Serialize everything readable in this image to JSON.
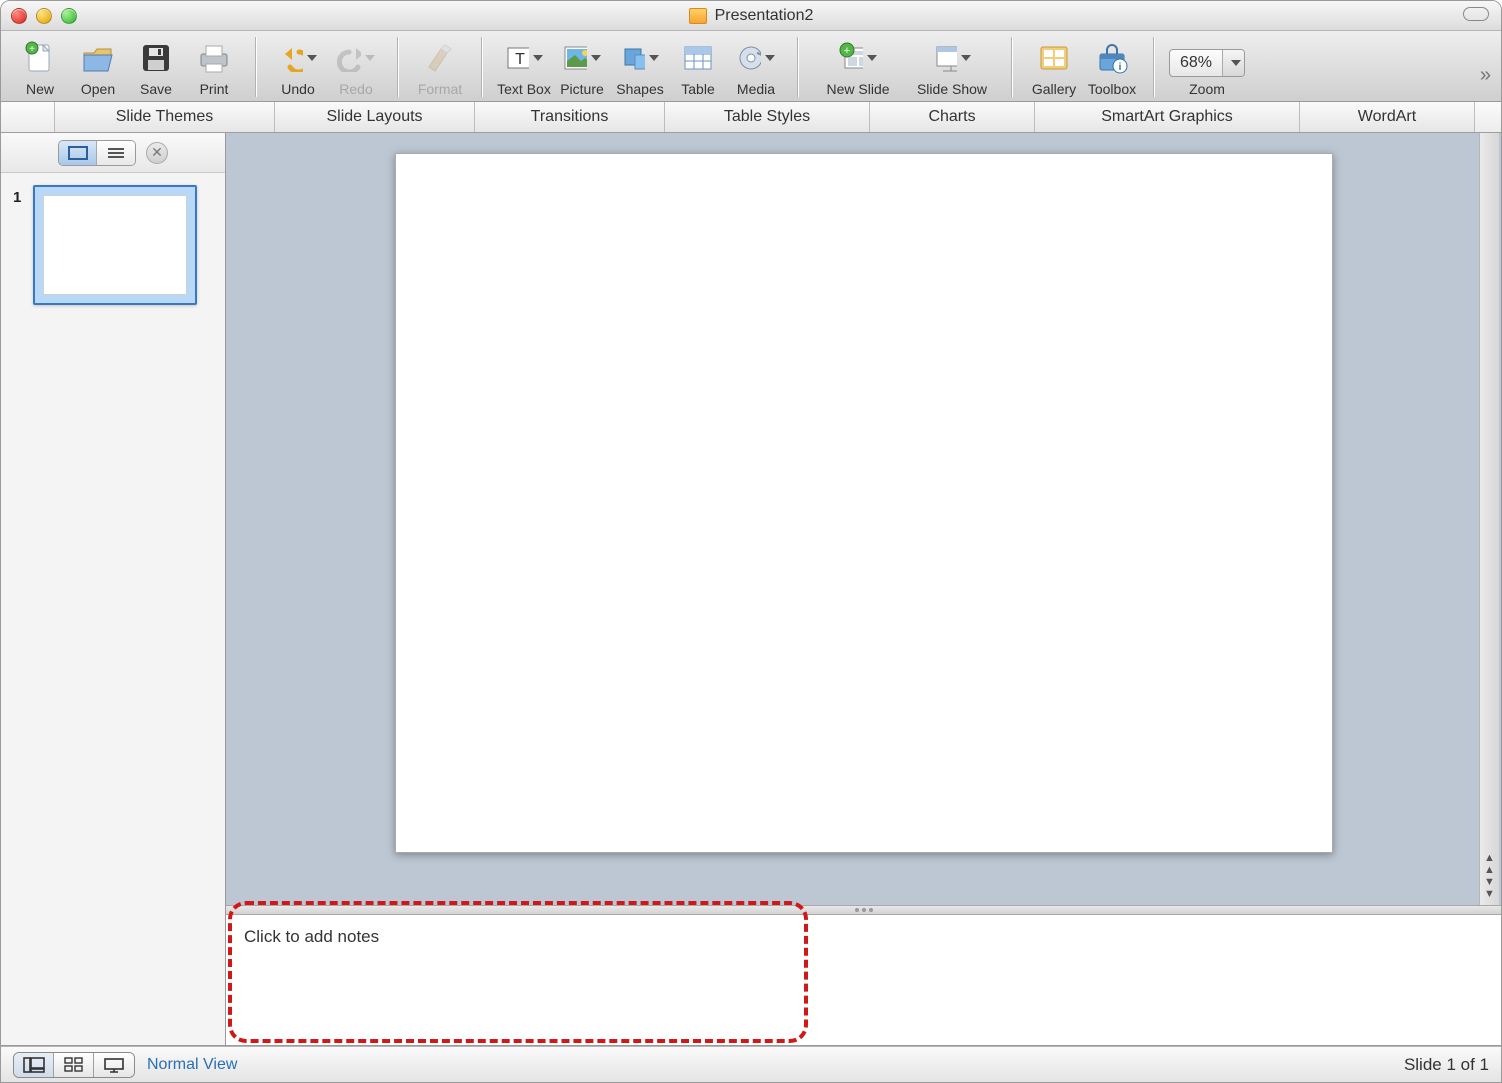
{
  "window": {
    "title": "Presentation2"
  },
  "toolbar": {
    "new": "New",
    "open": "Open",
    "save": "Save",
    "print": "Print",
    "undo": "Undo",
    "redo": "Redo",
    "format": "Format",
    "textbox": "Text Box",
    "picture": "Picture",
    "shapes": "Shapes",
    "table": "Table",
    "media": "Media",
    "newslide": "New Slide",
    "slideshow": "Slide Show",
    "gallery": "Gallery",
    "toolbox": "Toolbox",
    "zoom_label": "Zoom",
    "zoom_value": "68%"
  },
  "ribbon": {
    "tabs": [
      "Slide Themes",
      "Slide Layouts",
      "Transitions",
      "Table Styles",
      "Charts",
      "SmartArt Graphics",
      "WordArt"
    ]
  },
  "sidebar": {
    "view_slides_icon": "slides-view-icon",
    "view_outline_icon": "outline-view-icon",
    "thumbs": [
      {
        "number": "1"
      }
    ]
  },
  "notes": {
    "placeholder": "Click to add notes"
  },
  "status": {
    "view_label": "Normal View",
    "slide_counter": "Slide 1 of 1"
  }
}
